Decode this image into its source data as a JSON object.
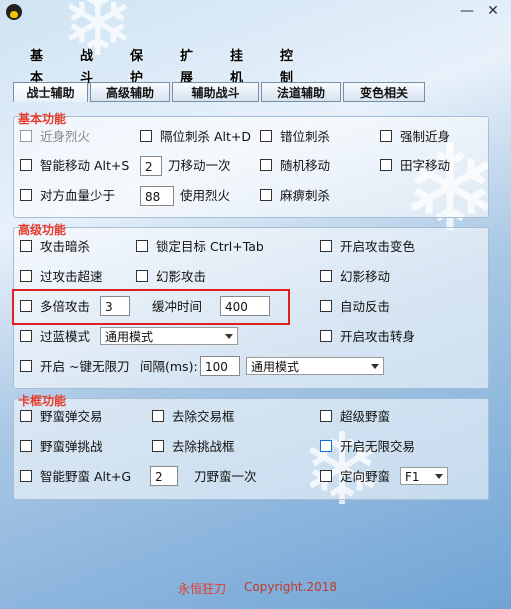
{
  "window": {
    "minimize": "—",
    "close": "✕"
  },
  "menu": [
    "基本",
    "战斗",
    "保护",
    "扩展",
    "挂机",
    "控制"
  ],
  "tabs": [
    "战士辅助",
    "高级辅助",
    "辅助战斗",
    "法道辅助",
    "变色相关"
  ],
  "basic": {
    "title": "基本功能",
    "r1": [
      "近身烈火",
      "隔位刺杀  Alt+D",
      "错位刺杀",
      "强制近身"
    ],
    "r2": {
      "a": "智能移动  Alt+S",
      "a_val": "2",
      "a_suffix": "刀移动一次",
      "b": "随机移动",
      "c": "田字移动"
    },
    "r3": {
      "a": "对方血量少于",
      "a_val": "88",
      "a_suffix": "使用烈火",
      "b": "麻痹刺杀"
    }
  },
  "advanced": {
    "title": "高级功能",
    "r1": [
      "攻击暗杀",
      "锁定目标  Ctrl+Tab",
      "开启攻击变色"
    ],
    "r2": [
      "过攻击超速",
      "幻影攻击",
      "幻影移动"
    ],
    "r3": {
      "a": "多倍攻击",
      "a_val": "3",
      "mid": "缓冲时间",
      "mid_val": "400",
      "c": "自动反击"
    },
    "r4": {
      "a": "过蓝模式",
      "select": "通用模式",
      "c": "开启攻击转身"
    },
    "r5": {
      "a": "开启 ~键无限刀",
      "mid": "间隔(ms):",
      "mid_val": "100",
      "select": "通用模式"
    }
  },
  "card": {
    "title": "卡框功能",
    "r1": [
      "野蛮弹交易",
      "去除交易框",
      "超级野蛮"
    ],
    "r2": [
      "野蛮弹挑战",
      "去除挑战框",
      "开启无限交易"
    ],
    "r3": {
      "a": "智能野蛮  Alt+G",
      "a_val": "2",
      "a_suffix": "刀野蛮一次",
      "c": "定向野蛮",
      "select": "F1"
    }
  },
  "footer": {
    "brand": "永恒狂刀",
    "copy": "Copyright.2018"
  },
  "colors": {
    "accent_red": "#e63a2a",
    "highlight": "#e02020",
    "checkbox_blue": "#1a6ee0"
  }
}
